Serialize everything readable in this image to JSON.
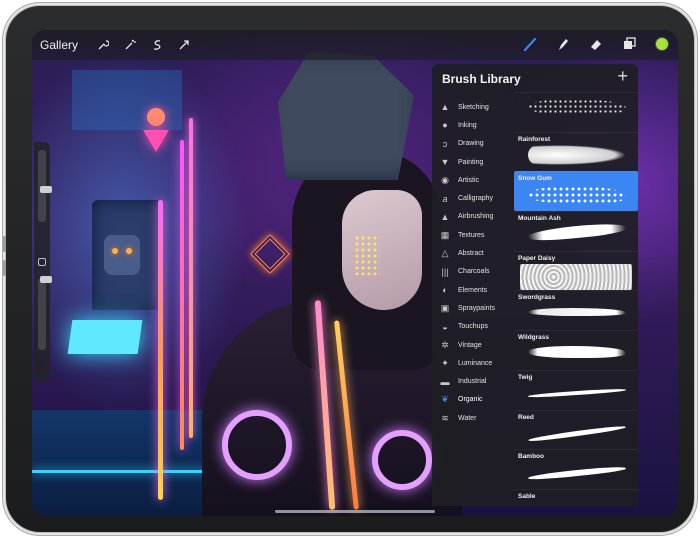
{
  "topbar": {
    "gallery_label": "Gallery",
    "left_tools": [
      "wrench-icon",
      "magic-wand-icon",
      "selection-icon",
      "transform-icon"
    ],
    "right_tools": [
      "brush-icon",
      "smudge-icon",
      "eraser-icon",
      "layers-icon"
    ],
    "active_tool": "brush-icon",
    "active_tool_color": "#3b86f2",
    "current_color": "#a6e33a"
  },
  "brush_library": {
    "title": "Brush Library",
    "add_label": "+",
    "brush_sets": [
      {
        "label": "Sketching",
        "icon": "pencil-icon"
      },
      {
        "label": "Inking",
        "icon": "ink-drop-icon"
      },
      {
        "label": "Drawing",
        "icon": "swirl-icon"
      },
      {
        "label": "Painting",
        "icon": "paint-brush-icon"
      },
      {
        "label": "Artistic",
        "icon": "palette-icon"
      },
      {
        "label": "Calligraphy",
        "icon": "calligraphy-icon"
      },
      {
        "label": "Airbrushing",
        "icon": "airbrush-icon"
      },
      {
        "label": "Textures",
        "icon": "texture-icon"
      },
      {
        "label": "Abstract",
        "icon": "triangle-icon"
      },
      {
        "label": "Charcoals",
        "icon": "charcoal-icon"
      },
      {
        "label": "Elements",
        "icon": "yin-yang-icon"
      },
      {
        "label": "Spraypaints",
        "icon": "spray-can-icon"
      },
      {
        "label": "Touchups",
        "icon": "touchup-icon"
      },
      {
        "label": "Vintage",
        "icon": "vintage-icon"
      },
      {
        "label": "Luminance",
        "icon": "sparkle-icon"
      },
      {
        "label": "Industrial",
        "icon": "anvil-icon"
      },
      {
        "label": "Organic",
        "icon": "leaf-icon"
      },
      {
        "label": "Water",
        "icon": "waves-icon"
      }
    ],
    "active_set": "Organic",
    "brushes": [
      {
        "name": "",
        "stroke": "s-speck"
      },
      {
        "name": "Rainforest",
        "stroke": "s-cloud"
      },
      {
        "name": "Snow Gum",
        "stroke": "s-snow"
      },
      {
        "name": "Mountain Ash",
        "stroke": "s-ash"
      },
      {
        "name": "Paper Daisy",
        "stroke": "s-daisy"
      },
      {
        "name": "Swordgrass",
        "stroke": "s-grass"
      },
      {
        "name": "Wildgrass",
        "stroke": "s-wild"
      },
      {
        "name": "Twig",
        "stroke": "s-twig"
      },
      {
        "name": "Reed",
        "stroke": "s-reed"
      },
      {
        "name": "Bamboo",
        "stroke": "s-bamboo"
      },
      {
        "name": "Sable",
        "stroke": "s-sable"
      }
    ],
    "selected_brush": "Snow Gum",
    "selection_color": "#3b86f2"
  }
}
